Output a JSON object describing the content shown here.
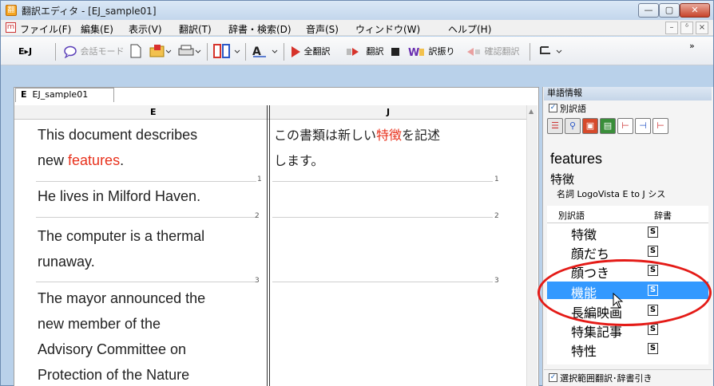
{
  "window": {
    "title": "翻訳エディタ - [EJ_sample01]",
    "app_icon_glyph": "翻",
    "min_glyph": "—",
    "max_glyph": "▢",
    "close_glyph": "✕"
  },
  "menubar": {
    "doc_icon_glyph": "ｍ",
    "items": [
      "ファイル(F)",
      "編集(E)",
      "表示(V)",
      "翻訳(T)",
      "辞書・検索(D)",
      "音声(S)",
      "ウィンドウ(W)",
      "ヘルプ(H)"
    ],
    "mdi_min": "–",
    "mdi_restore": "ᵟ",
    "mdi_close": "×"
  },
  "toolbar": {
    "direction": "E▸J",
    "chat_mode": "会話モード",
    "translate_all": "全翻訳",
    "translate": "翻訳",
    "word_assign": "訳振り",
    "confirm_translate": "確認翻訳",
    "more": "»"
  },
  "document": {
    "tab_label": "EJ_sample01",
    "tab_prefix": "E",
    "col_e": "E",
    "col_j": "J",
    "segments": [
      {
        "num": "1",
        "en_lines": [
          "This document describes",
          "new ",
          "features",
          "."
        ],
        "ja_lines": [
          "この書類は新しい",
          "特徴",
          "を記述",
          "します。"
        ]
      },
      {
        "num": "2",
        "en_lines": [
          "He lives in Milford Haven."
        ],
        "ja_lines": []
      },
      {
        "num": "3",
        "en_lines": [
          "The computer is a thermal",
          "runaway."
        ],
        "ja_lines": []
      },
      {
        "num": "",
        "en_lines": [
          "The mayor announced the",
          "new member of the",
          "Advisory Committee on",
          "Protection of the Nature"
        ],
        "ja_lines": []
      }
    ]
  },
  "panel": {
    "title": "単語情報",
    "alt_checkbox_label": "別訳語",
    "word_en": "features",
    "word_ja": "特徴",
    "pos_line": "名詞  LogoVista E to J シス",
    "alt_col_label": "別訳語",
    "dict_col_label": "辞書",
    "alternatives": [
      {
        "word": "特徴",
        "dict": "S",
        "selected": false
      },
      {
        "word": "顔だち",
        "dict": "S",
        "selected": false
      },
      {
        "word": "顔つき",
        "dict": "S",
        "selected": false
      },
      {
        "word": "機能",
        "dict": "S",
        "selected": true
      },
      {
        "word": "長編映画",
        "dict": "S",
        "selected": false
      },
      {
        "word": "特集記事",
        "dict": "S",
        "selected": false
      },
      {
        "word": "特性",
        "dict": "S",
        "selected": false
      }
    ],
    "bottom_checkbox_label": "選択範囲翻訳･辞書引き"
  },
  "colors": {
    "highlight_red": "#e8311c",
    "selection_blue": "#3399ff",
    "callout_red": "#e41b17"
  }
}
